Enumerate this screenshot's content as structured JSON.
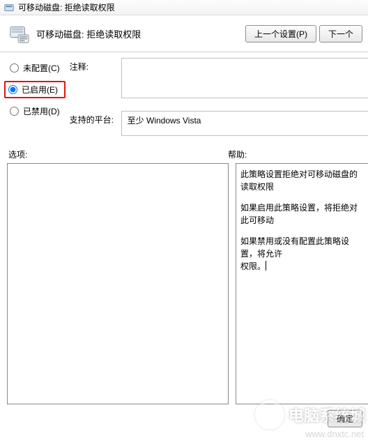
{
  "window": {
    "title": "可移动磁盘: 拒绝读取权限"
  },
  "header": {
    "title": "可移动磁盘: 拒绝读取权限",
    "prev_button": "上一个设置(P)",
    "next_button": "下一个"
  },
  "radios": {
    "not_configured": "未配置(C)",
    "enabled": "已启用(E)",
    "disabled": "已禁用(D)",
    "selected": "enabled"
  },
  "fields": {
    "comment_label": "注释:",
    "comment_value": "",
    "platform_label": "支持的平台:",
    "platform_value": "至少 Windows Vista"
  },
  "sections": {
    "options_label": "选项:",
    "help_label": "帮助:"
  },
  "help": {
    "p1": "此策略设置拒绝对可移动磁盘的读取权限",
    "p2": "如果启用此策略设置，将拒绝对此可移动",
    "p3a": "如果禁用或没有配置此策略设置，将允许",
    "p3b": "权限。"
  },
  "footer": {
    "ok": "确定"
  },
  "watermark": {
    "text": "电脑系统城",
    "sub": "www.dnxtc.net"
  }
}
